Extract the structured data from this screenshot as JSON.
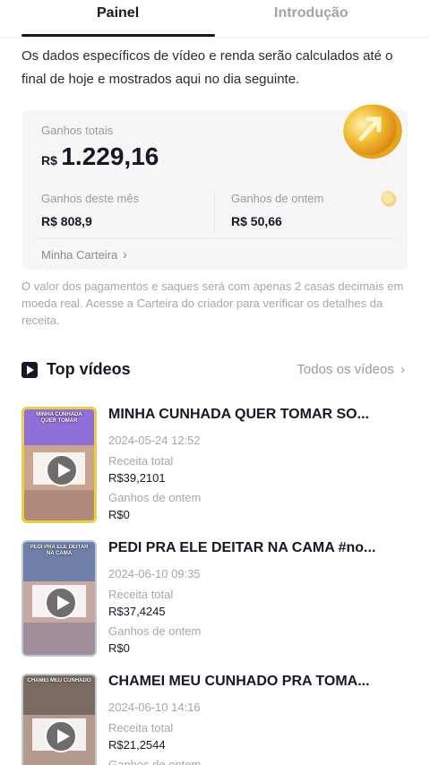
{
  "tabs": {
    "active": "Painel",
    "inactive": "Introdução"
  },
  "notice": "Os dados específicos de vídeo e renda serão calculados até o final de hoje e mostrados aqui no dia seguinte.",
  "earnings": {
    "total_label": "Ganhos totais",
    "total_currency": "R$",
    "total_value": "1.229,16",
    "month_label": "Ganhos deste mês",
    "month_value": "R$ 808,9",
    "yesterday_label": "Ganhos de ontem",
    "yesterday_value": "R$ 50,66",
    "wallet_label": "Minha Carteira",
    "wallet_chevron": "›"
  },
  "disclaimer": "O valor dos pagamentos e saques será com apenas 2 casas decimais em moeda real. Acesse a Carteira do criador para verificar os detalhes da receita.",
  "top_videos": {
    "title": "Top vídeos",
    "all_label": "Todos os vídeos",
    "chevron": "›"
  },
  "videos": [
    {
      "title": "MINHA CUNHADA QUER TOMAR SO...",
      "date": "2024-05-24 12:52",
      "revenue_label": "Receita total",
      "revenue": "R$39,2101",
      "yesterday_label": "Ganhos de ontem",
      "yesterday": "R$0",
      "thumb_text": "MINHA CUNHADA QUER TOMAR",
      "border_color": "#e7cf4a"
    },
    {
      "title": "PEDI PRA ELE DEITAR NA CAMA #no...",
      "date": "2024-06-10 09:35",
      "revenue_label": "Receita total",
      "revenue": "R$37,4245",
      "yesterday_label": "Ganhos de ontem",
      "yesterday": "R$0",
      "thumb_text": "PEDI PRA ELE DEITAR NA CAMA",
      "border_color": "#b9c6d9"
    },
    {
      "title": "CHAMEI MEU CUNHADO PRA TOMA...",
      "date": "2024-06-10 14:16",
      "revenue_label": "Receita total",
      "revenue": "R$21,2544",
      "yesterday_label": "Ganhos de ontem",
      "yesterday": "",
      "thumb_text": "CHAMEI MEU CUNHADO",
      "border_color": "#c4c7cc"
    }
  ]
}
